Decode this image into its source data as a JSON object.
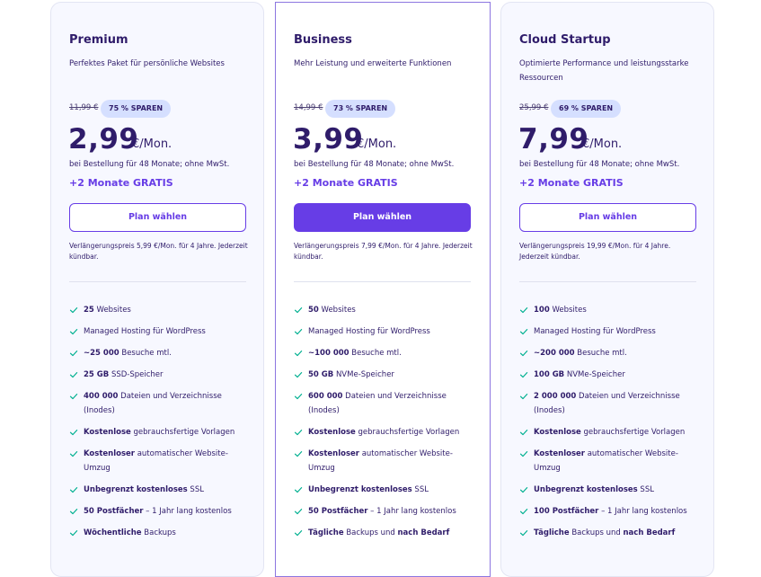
{
  "colors": {
    "accent": "#673de6",
    "text": "#2f1c6a",
    "badge_bg": "#d5dfff",
    "card_bg": "#f7f8ff",
    "check": "#00b090"
  },
  "icons": {
    "feature_bullet": "check-icon"
  },
  "plans": [
    {
      "name": "Premium",
      "description": "Perfektes Paket für persönliche Websites",
      "old_price": "11,99 €",
      "save_badge": "75 % SPAREN",
      "price": "2,99",
      "unit": "€/Mon.",
      "billing": "bei Bestellung für 48 Monate; ohne MwSt.",
      "bonus": "+2 Monate GRATIS",
      "cta": "Plan wählen",
      "renewal": "Verlängerungspreis 5,99 €/Mon. für 4 Jahre. Jederzeit kündbar.",
      "features": [
        {
          "bold": "25",
          "text": " Websites"
        },
        {
          "bold": "",
          "text": "Managed Hosting für WordPress"
        },
        {
          "bold": "~25 000",
          "text": " Besuche mtl."
        },
        {
          "bold": "25 GB",
          "text": " SSD-Speicher"
        },
        {
          "bold": "400 000",
          "text": " Dateien und Verzeichnisse (Inodes)"
        },
        {
          "bold": "Kostenlose",
          "text": " gebrauchsfertige Vorlagen"
        },
        {
          "bold": "Kostenloser",
          "text": " automatischer Website-Umzug"
        },
        {
          "bold": "Unbegrenzt kostenloses",
          "text": " SSL"
        },
        {
          "bold": "50 Postfächer",
          "text": " – 1 Jahr lang kostenlos"
        },
        {
          "bold": "Wöchentliche",
          "text": " Backups"
        }
      ]
    },
    {
      "name": "Business",
      "description": "Mehr Leistung und erweiterte Funktionen",
      "old_price": "14,99 €",
      "save_badge": "73 % SPAREN",
      "price": "3,99",
      "unit": "€/Mon.",
      "billing": "bei Bestellung für 48 Monate; ohne MwSt.",
      "bonus": "+2 Monate GRATIS",
      "cta": "Plan wählen",
      "renewal": "Verlängerungspreis 7,99 €/Mon. für 4 Jahre. Jederzeit kündbar.",
      "features": [
        {
          "bold": "50",
          "text": " Websites"
        },
        {
          "bold": "",
          "text": "Managed Hosting für WordPress"
        },
        {
          "bold": "~100 000",
          "text": " Besuche mtl."
        },
        {
          "bold": "50 GB",
          "text": " NVMe-Speicher"
        },
        {
          "bold": "600 000",
          "text": " Dateien und Verzeichnisse (Inodes)"
        },
        {
          "bold": "Kostenlose",
          "text": " gebrauchsfertige Vorlagen"
        },
        {
          "bold": "Kostenloser",
          "text": " automatischer Website-Umzug"
        },
        {
          "bold": "Unbegrenzt kostenloses",
          "text": " SSL"
        },
        {
          "bold": "50 Postfächer",
          "text": " – 1 Jahr lang kostenlos"
        },
        {
          "bold": "Tägliche",
          "text": " Backups und ",
          "bold2": "nach Bedarf"
        }
      ]
    },
    {
      "name": "Cloud Startup",
      "description": "Optimierte Performance und leistungsstarke Ressourcen",
      "old_price": "25,99 €",
      "save_badge": "69 % SPAREN",
      "price": "7,99",
      "unit": "€/Mon.",
      "billing": "bei Bestellung für 48 Monate; ohne MwSt.",
      "bonus": "+2 Monate GRATIS",
      "cta": "Plan wählen",
      "renewal": "Verlängerungspreis 19,99 €/Mon. für 4 Jahre. Jederzeit kündbar.",
      "features": [
        {
          "bold": "100",
          "text": " Websites"
        },
        {
          "bold": "",
          "text": "Managed Hosting für WordPress"
        },
        {
          "bold": "~200 000",
          "text": " Besuche mtl."
        },
        {
          "bold": "100 GB",
          "text": " NVMe-Speicher"
        },
        {
          "bold": "2 000 000",
          "text": " Dateien und Verzeichnisse (Inodes)"
        },
        {
          "bold": "Kostenlose",
          "text": " gebrauchsfertige Vorlagen"
        },
        {
          "bold": "Kostenloser",
          "text": " automatischer Website-Umzug"
        },
        {
          "bold": "Unbegrenzt kostenloses",
          "text": " SSL"
        },
        {
          "bold": "100 Postfächer",
          "text": " – 1 Jahr lang kostenlos"
        },
        {
          "bold": "Tägliche",
          "text": " Backups und ",
          "bold2": "nach Bedarf"
        }
      ]
    }
  ]
}
